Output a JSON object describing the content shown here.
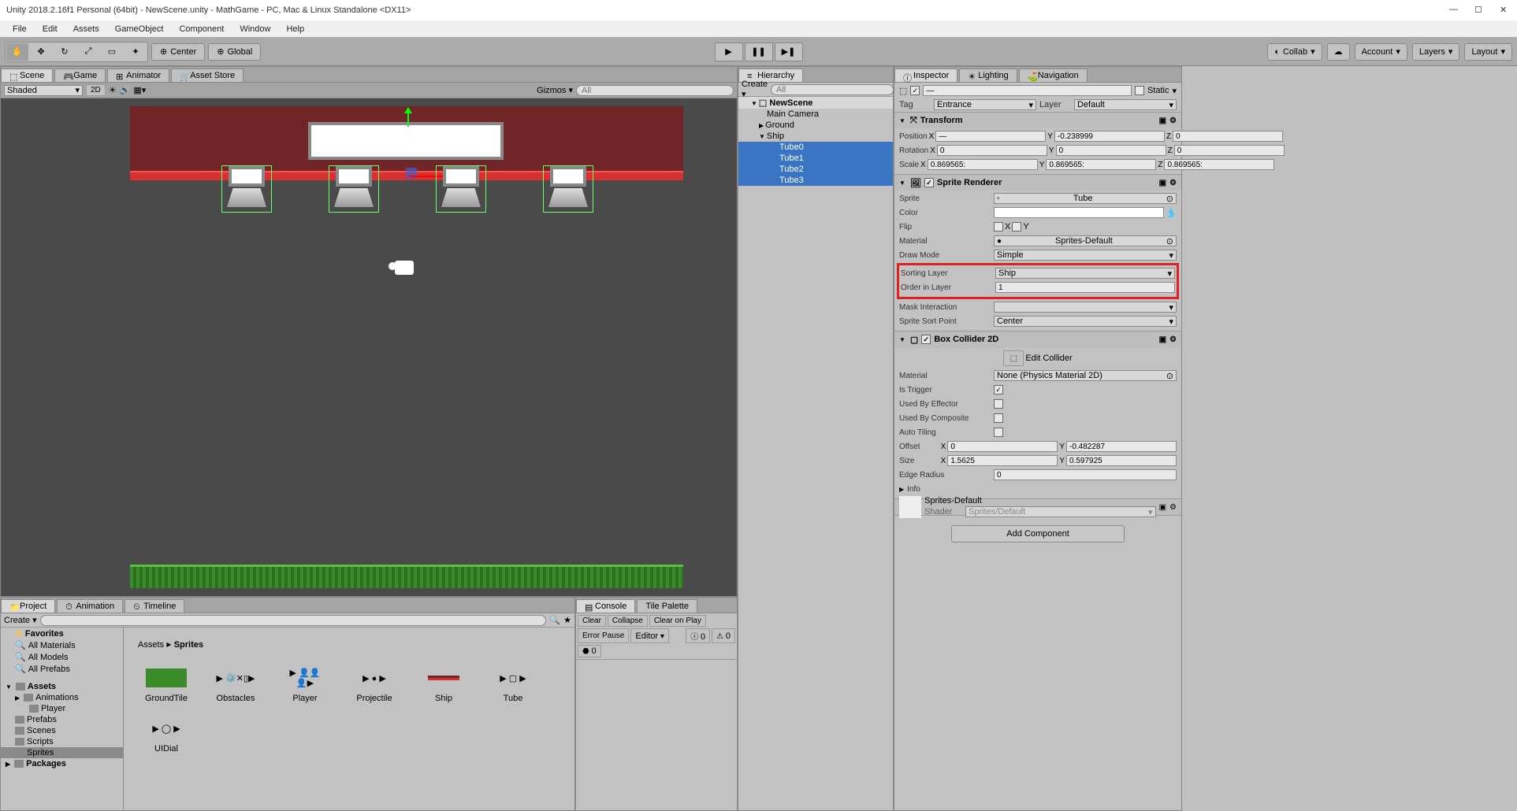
{
  "window": {
    "title": "Unity 2018.2.16f1 Personal (64bit) - NewScene.unity - MathGame - PC, Mac & Linux Standalone <DX11>"
  },
  "menubar": [
    "File",
    "Edit",
    "Assets",
    "GameObject",
    "Component",
    "Window",
    "Help"
  ],
  "toolbar": {
    "center": "Center",
    "global": "Global",
    "collab": "Collab",
    "account": "Account",
    "layers": "Layers",
    "layout": "Layout"
  },
  "scene": {
    "tabs": [
      "Scene",
      "Game",
      "Animator",
      "Asset Store"
    ],
    "shaded": "Shaded",
    "mode2d": "2D",
    "gizmos": "Gizmos"
  },
  "hierarchy": {
    "tab": "Hierarchy",
    "create": "Create",
    "scene_name": "NewScene",
    "items": [
      {
        "label": "Main Camera",
        "level": 1,
        "sel": false
      },
      {
        "label": "Ground",
        "level": 1,
        "sel": false
      },
      {
        "label": "Ship",
        "level": 1,
        "sel": false
      },
      {
        "label": "Tube0",
        "level": 2,
        "sel": true
      },
      {
        "label": "Tube1",
        "level": 2,
        "sel": true
      },
      {
        "label": "Tube2",
        "level": 2,
        "sel": true
      },
      {
        "label": "Tube3",
        "level": 2,
        "sel": true
      }
    ]
  },
  "project": {
    "tabs": [
      "Project",
      "Animation",
      "Timeline"
    ],
    "create": "Create",
    "favorites": "Favorites",
    "fav_items": [
      "All Materials",
      "All Models",
      "All Prefabs"
    ],
    "assets": "Assets",
    "folders": [
      "Animations",
      "Player",
      "Prefabs",
      "Scenes",
      "Scripts",
      "Sprites"
    ],
    "packages": "Packages",
    "breadcrumb_root": "Assets",
    "breadcrumb_leaf": "Sprites",
    "sprites": [
      "GroundTile",
      "Obstacles",
      "Player",
      "Projectile",
      "Ship",
      "Tube",
      "UIDial"
    ]
  },
  "console": {
    "tabs": [
      "Console",
      "Tile Palette"
    ],
    "buttons": [
      "Clear",
      "Collapse",
      "Clear on Play",
      "Error Pause",
      "Editor"
    ],
    "count0": "0",
    "count1": "0",
    "count2": "0"
  },
  "inspector": {
    "tabs": [
      "Inspector",
      "Lighting",
      "Navigation"
    ],
    "name": "—",
    "static": "Static",
    "tag_label": "Tag",
    "tag": "Entrance",
    "layer_label": "Layer",
    "layer": "Default",
    "transform": {
      "title": "Transform",
      "position": "Position",
      "px": "—",
      "py": "-0.238999",
      "pz": "0",
      "rotation": "Rotation",
      "rx": "0",
      "ry": "0",
      "rz": "0",
      "scale": "Scale",
      "sx": "0.869565:",
      "sy": "0.869565:",
      "sz": "0.869565:"
    },
    "sprite_renderer": {
      "title": "Sprite Renderer",
      "sprite_label": "Sprite",
      "sprite": "Tube",
      "color_label": "Color",
      "flip_label": "Flip",
      "flip_x": "X",
      "flip_y": "Y",
      "material_label": "Material",
      "material": "Sprites-Default",
      "draw_mode_label": "Draw Mode",
      "draw_mode": "Simple",
      "sorting_layer_label": "Sorting Layer",
      "sorting_layer": "Ship",
      "order_label": "Order in Layer",
      "order": "1",
      "mask_label": "Mask Interaction",
      "sort_point_label": "Sprite Sort Point",
      "sort_point": "Center"
    },
    "box_collider": {
      "title": "Box Collider 2D",
      "edit_collider": "Edit Collider",
      "material_label": "Material",
      "material": "None (Physics Material 2D)",
      "is_trigger_label": "Is Trigger",
      "used_effector_label": "Used By Effector",
      "used_composite_label": "Used By Composite",
      "auto_tiling_label": "Auto Tiling",
      "offset_label": "Offset",
      "ox": "0",
      "oy": "-0.482287",
      "size_label": "Size",
      "sx": "1.5625",
      "sy": "0.597925",
      "edge_radius_label": "Edge Radius",
      "edge_radius": "0",
      "info_label": "Info"
    },
    "material_footer": {
      "name": "Sprites-Default",
      "shader_label": "Shader",
      "shader": "Sprites/Default"
    },
    "add_component": "Add Component"
  }
}
